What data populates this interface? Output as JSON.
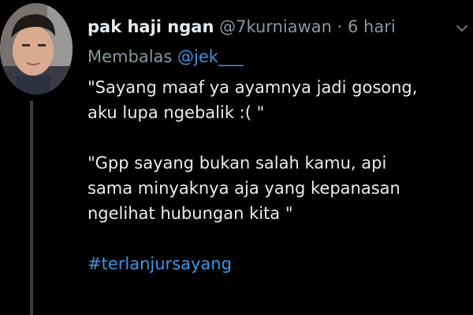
{
  "author": {
    "display_name": "pak haji ngan",
    "handle": "@7kurniawan",
    "separator": "·",
    "timestamp": "6 hari"
  },
  "reply": {
    "prefix": "Membalas",
    "to_handle": "@jek___"
  },
  "body": {
    "paragraph_1_line_1": "\"Sayang maaf ya ayamnya jadi gosong,",
    "paragraph_1_line_2": "aku lupa ngebalik :( \"",
    "paragraph_2_line_1": "\"Gpp sayang bukan salah kamu, api",
    "paragraph_2_line_2": "sama minyaknya aja yang kepanasan",
    "paragraph_2_line_3": "ngelihat hubungan kita \"",
    "hashtag": "#terlanjursayang"
  },
  "icons": {
    "more": "chevron-down-icon",
    "avatar": "avatar"
  },
  "colors": {
    "background": "#000000",
    "text": "#e9ecee",
    "muted": "#8b979f",
    "link": "#3b96e4",
    "thread_line": "#3a3d40"
  }
}
